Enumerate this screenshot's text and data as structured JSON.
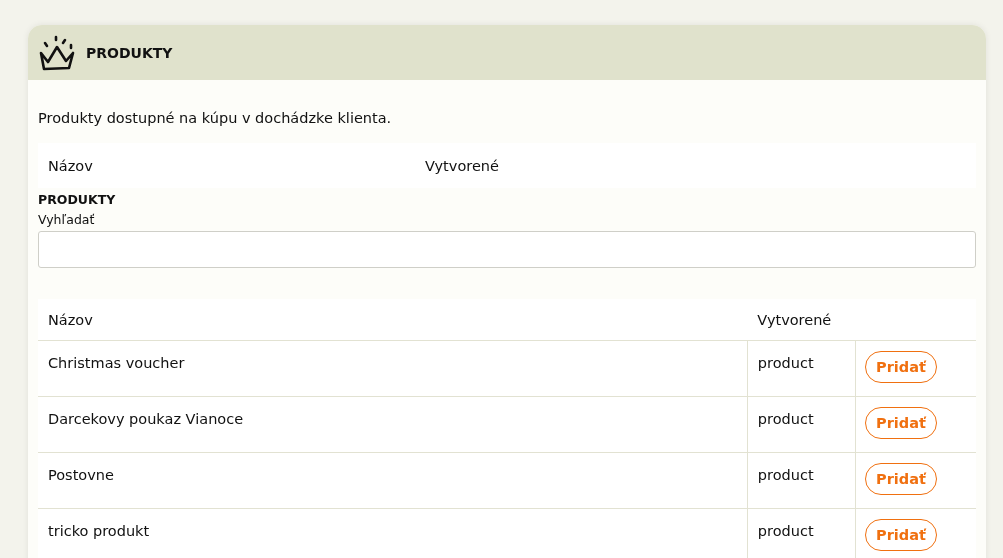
{
  "panel": {
    "title": "PRODUKTY"
  },
  "description": "Produkty dostupné na kúpu v dochádzke klienta.",
  "summary_table": {
    "columns": [
      "Názov",
      "Vytvorené"
    ]
  },
  "section": {
    "title": "PRODUKTY",
    "search_label": "Vyhľadať"
  },
  "products_table": {
    "columns": [
      "Názov",
      "Vytvorené"
    ],
    "rows": [
      {
        "name": "Christmas voucher",
        "created": "product",
        "action": "Pridať"
      },
      {
        "name": "Darcekovy poukaz Vianoce",
        "created": "product",
        "action": "Pridať"
      },
      {
        "name": "Postovne",
        "created": "product",
        "action": "Pridať"
      },
      {
        "name": "tricko produkt",
        "created": "product",
        "action": "Pridať"
      }
    ]
  }
}
